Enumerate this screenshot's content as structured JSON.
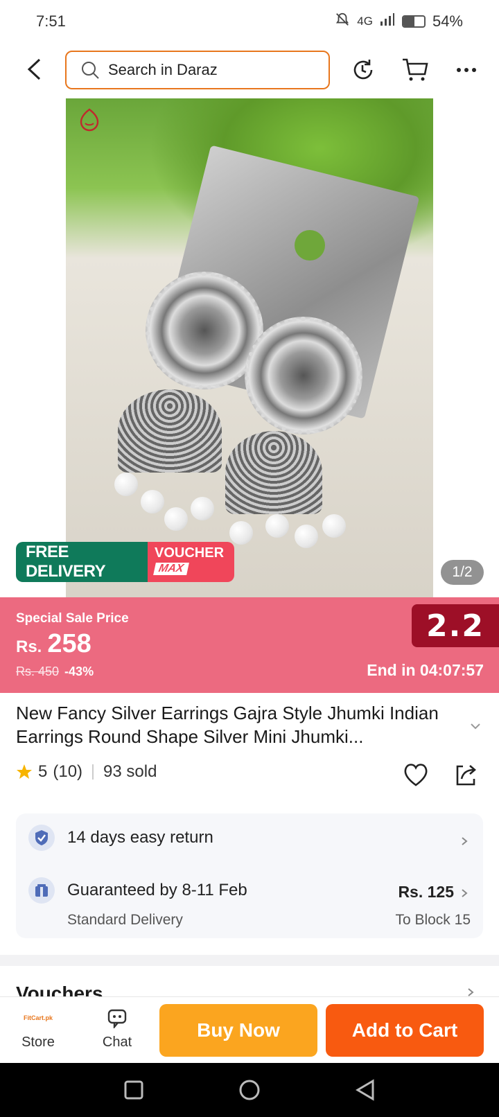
{
  "status_bar": {
    "time": "7:51",
    "network": "4G",
    "battery_percent": "54%",
    "battery_level": 0.54
  },
  "top_nav": {
    "search_placeholder": "Search in Daraz",
    "icons": [
      "back-arrow-icon",
      "search-icon",
      "history-icon",
      "cart-icon",
      "more-icon"
    ]
  },
  "product_image": {
    "page_indicator": "1/2",
    "badges": {
      "free_delivery": "FREE DELIVERY",
      "voucher": "VOUCHER",
      "voucher_max": "MAX"
    }
  },
  "sale": {
    "label": "Special Sale Price",
    "currency": "Rs.",
    "price": "258",
    "original_price": "Rs. 450",
    "discount": "-43%",
    "campaign": "2.2",
    "timer": "End in 04:07:57",
    "colors": {
      "banner": "#ec6a80",
      "campaign": "#9d0f27"
    }
  },
  "product": {
    "title": "New Fancy Silver Earrings Gajra Style Jhumki Indian Earrings Round Shape Silver Mini Jhumki...",
    "rating": "5",
    "reviews": "(10)",
    "sold": "93 sold"
  },
  "services": {
    "return": {
      "label": "14 days easy return"
    },
    "delivery": {
      "label": "Guaranteed by 8-11 Feb",
      "sub": "Standard Delivery",
      "price": "Rs. 125",
      "location": "To Block 15"
    }
  },
  "vouchers_heading": "Vouchers",
  "action_bar": {
    "store_label": "Store",
    "chat_label": "Chat",
    "buy_now": "Buy Now",
    "add_to_cart": "Add to Cart",
    "colors": {
      "buy_now": "#fba51f",
      "add_to_cart": "#f85a10"
    }
  }
}
